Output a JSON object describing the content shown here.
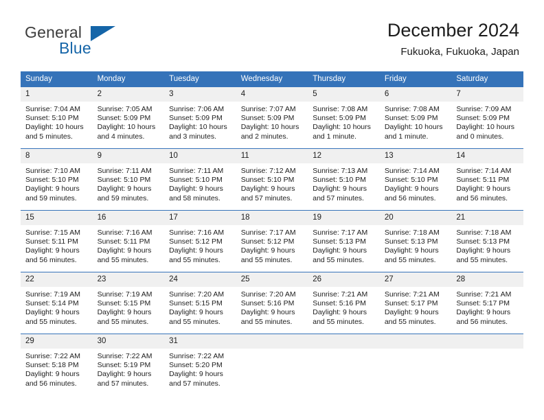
{
  "brand": {
    "name_part1": "General",
    "name_part2": "Blue",
    "mark": "triangle-logo"
  },
  "header": {
    "title": "December 2024",
    "subtitle": "Fukuoka, Fukuoka, Japan"
  },
  "colors": {
    "header_blue": "#3573b9",
    "brand_blue": "#1565a8",
    "daynum_band": "#f0f0f0",
    "text": "#1c1c1c"
  },
  "weekdays": [
    "Sunday",
    "Monday",
    "Tuesday",
    "Wednesday",
    "Thursday",
    "Friday",
    "Saturday"
  ],
  "weeks": [
    [
      {
        "day": "1",
        "sunrise": "Sunrise: 7:04 AM",
        "sunset": "Sunset: 5:10 PM",
        "daylight": "Daylight: 10 hours and 5 minutes."
      },
      {
        "day": "2",
        "sunrise": "Sunrise: 7:05 AM",
        "sunset": "Sunset: 5:09 PM",
        "daylight": "Daylight: 10 hours and 4 minutes."
      },
      {
        "day": "3",
        "sunrise": "Sunrise: 7:06 AM",
        "sunset": "Sunset: 5:09 PM",
        "daylight": "Daylight: 10 hours and 3 minutes."
      },
      {
        "day": "4",
        "sunrise": "Sunrise: 7:07 AM",
        "sunset": "Sunset: 5:09 PM",
        "daylight": "Daylight: 10 hours and 2 minutes."
      },
      {
        "day": "5",
        "sunrise": "Sunrise: 7:08 AM",
        "sunset": "Sunset: 5:09 PM",
        "daylight": "Daylight: 10 hours and 1 minute."
      },
      {
        "day": "6",
        "sunrise": "Sunrise: 7:08 AM",
        "sunset": "Sunset: 5:09 PM",
        "daylight": "Daylight: 10 hours and 1 minute."
      },
      {
        "day": "7",
        "sunrise": "Sunrise: 7:09 AM",
        "sunset": "Sunset: 5:09 PM",
        "daylight": "Daylight: 10 hours and 0 minutes."
      }
    ],
    [
      {
        "day": "8",
        "sunrise": "Sunrise: 7:10 AM",
        "sunset": "Sunset: 5:10 PM",
        "daylight": "Daylight: 9 hours and 59 minutes."
      },
      {
        "day": "9",
        "sunrise": "Sunrise: 7:11 AM",
        "sunset": "Sunset: 5:10 PM",
        "daylight": "Daylight: 9 hours and 59 minutes."
      },
      {
        "day": "10",
        "sunrise": "Sunrise: 7:11 AM",
        "sunset": "Sunset: 5:10 PM",
        "daylight": "Daylight: 9 hours and 58 minutes."
      },
      {
        "day": "11",
        "sunrise": "Sunrise: 7:12 AM",
        "sunset": "Sunset: 5:10 PM",
        "daylight": "Daylight: 9 hours and 57 minutes."
      },
      {
        "day": "12",
        "sunrise": "Sunrise: 7:13 AM",
        "sunset": "Sunset: 5:10 PM",
        "daylight": "Daylight: 9 hours and 57 minutes."
      },
      {
        "day": "13",
        "sunrise": "Sunrise: 7:14 AM",
        "sunset": "Sunset: 5:10 PM",
        "daylight": "Daylight: 9 hours and 56 minutes."
      },
      {
        "day": "14",
        "sunrise": "Sunrise: 7:14 AM",
        "sunset": "Sunset: 5:11 PM",
        "daylight": "Daylight: 9 hours and 56 minutes."
      }
    ],
    [
      {
        "day": "15",
        "sunrise": "Sunrise: 7:15 AM",
        "sunset": "Sunset: 5:11 PM",
        "daylight": "Daylight: 9 hours and 56 minutes."
      },
      {
        "day": "16",
        "sunrise": "Sunrise: 7:16 AM",
        "sunset": "Sunset: 5:11 PM",
        "daylight": "Daylight: 9 hours and 55 minutes."
      },
      {
        "day": "17",
        "sunrise": "Sunrise: 7:16 AM",
        "sunset": "Sunset: 5:12 PM",
        "daylight": "Daylight: 9 hours and 55 minutes."
      },
      {
        "day": "18",
        "sunrise": "Sunrise: 7:17 AM",
        "sunset": "Sunset: 5:12 PM",
        "daylight": "Daylight: 9 hours and 55 minutes."
      },
      {
        "day": "19",
        "sunrise": "Sunrise: 7:17 AM",
        "sunset": "Sunset: 5:13 PM",
        "daylight": "Daylight: 9 hours and 55 minutes."
      },
      {
        "day": "20",
        "sunrise": "Sunrise: 7:18 AM",
        "sunset": "Sunset: 5:13 PM",
        "daylight": "Daylight: 9 hours and 55 minutes."
      },
      {
        "day": "21",
        "sunrise": "Sunrise: 7:18 AM",
        "sunset": "Sunset: 5:13 PM",
        "daylight": "Daylight: 9 hours and 55 minutes."
      }
    ],
    [
      {
        "day": "22",
        "sunrise": "Sunrise: 7:19 AM",
        "sunset": "Sunset: 5:14 PM",
        "daylight": "Daylight: 9 hours and 55 minutes."
      },
      {
        "day": "23",
        "sunrise": "Sunrise: 7:19 AM",
        "sunset": "Sunset: 5:15 PM",
        "daylight": "Daylight: 9 hours and 55 minutes."
      },
      {
        "day": "24",
        "sunrise": "Sunrise: 7:20 AM",
        "sunset": "Sunset: 5:15 PM",
        "daylight": "Daylight: 9 hours and 55 minutes."
      },
      {
        "day": "25",
        "sunrise": "Sunrise: 7:20 AM",
        "sunset": "Sunset: 5:16 PM",
        "daylight": "Daylight: 9 hours and 55 minutes."
      },
      {
        "day": "26",
        "sunrise": "Sunrise: 7:21 AM",
        "sunset": "Sunset: 5:16 PM",
        "daylight": "Daylight: 9 hours and 55 minutes."
      },
      {
        "day": "27",
        "sunrise": "Sunrise: 7:21 AM",
        "sunset": "Sunset: 5:17 PM",
        "daylight": "Daylight: 9 hours and 55 minutes."
      },
      {
        "day": "28",
        "sunrise": "Sunrise: 7:21 AM",
        "sunset": "Sunset: 5:17 PM",
        "daylight": "Daylight: 9 hours and 56 minutes."
      }
    ],
    [
      {
        "day": "29",
        "sunrise": "Sunrise: 7:22 AM",
        "sunset": "Sunset: 5:18 PM",
        "daylight": "Daylight: 9 hours and 56 minutes."
      },
      {
        "day": "30",
        "sunrise": "Sunrise: 7:22 AM",
        "sunset": "Sunset: 5:19 PM",
        "daylight": "Daylight: 9 hours and 57 minutes."
      },
      {
        "day": "31",
        "sunrise": "Sunrise: 7:22 AM",
        "sunset": "Sunset: 5:20 PM",
        "daylight": "Daylight: 9 hours and 57 minutes."
      },
      {
        "day": "",
        "sunrise": "",
        "sunset": "",
        "daylight": ""
      },
      {
        "day": "",
        "sunrise": "",
        "sunset": "",
        "daylight": ""
      },
      {
        "day": "",
        "sunrise": "",
        "sunset": "",
        "daylight": ""
      },
      {
        "day": "",
        "sunrise": "",
        "sunset": "",
        "daylight": ""
      }
    ]
  ]
}
